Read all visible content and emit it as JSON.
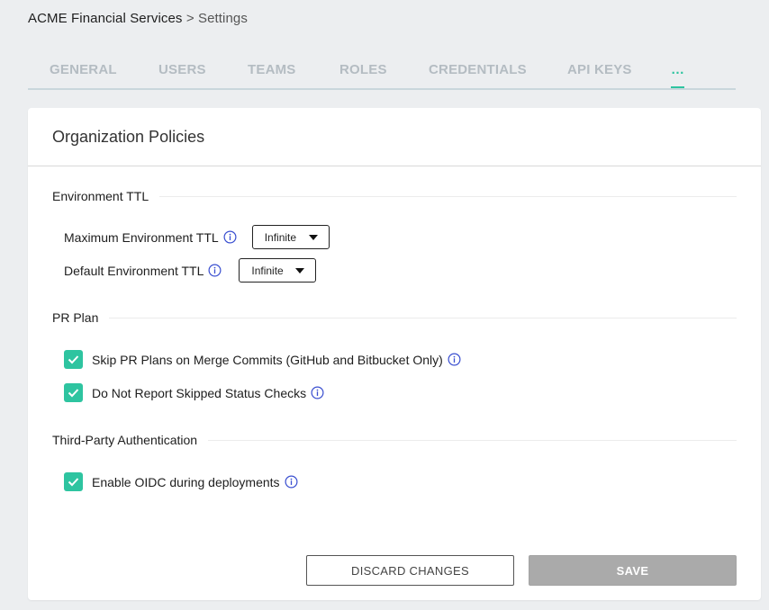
{
  "breadcrumb": {
    "org": "ACME Financial Services",
    "separator": ">",
    "current": "Settings"
  },
  "tabs": [
    {
      "label": "General"
    },
    {
      "label": "Users"
    },
    {
      "label": "Teams"
    },
    {
      "label": "Roles"
    },
    {
      "label": "Credentials"
    },
    {
      "label": "API Keys"
    },
    {
      "label": "…",
      "active": true
    }
  ],
  "card": {
    "title": "Organization Policies"
  },
  "environment_ttl": {
    "heading": "Environment TTL",
    "max": {
      "label": "Maximum Environment TTL",
      "value": "Infinite"
    },
    "default": {
      "label": "Default Environment TTL",
      "value": "Infinite"
    }
  },
  "pr_plan": {
    "heading": "PR Plan",
    "skip_merge": {
      "label": "Skip PR Plans on Merge Commits (GitHub and Bitbucket Only)",
      "checked": true
    },
    "no_report": {
      "label": "Do Not Report Skipped Status Checks",
      "checked": true
    }
  },
  "third_party": {
    "heading": "Third-Party Authentication",
    "oidc": {
      "label": "Enable OIDC during deployments",
      "checked": true
    }
  },
  "actions": {
    "discard": "Discard Changes",
    "save": "Save"
  },
  "colors": {
    "accent": "#2ec4a0",
    "info_icon": "#3a4fd0",
    "save_disabled": "#aaaaaa"
  },
  "icons": {
    "info": "info-circle-icon",
    "check": "checkmark-icon",
    "caret": "caret-down-icon"
  }
}
